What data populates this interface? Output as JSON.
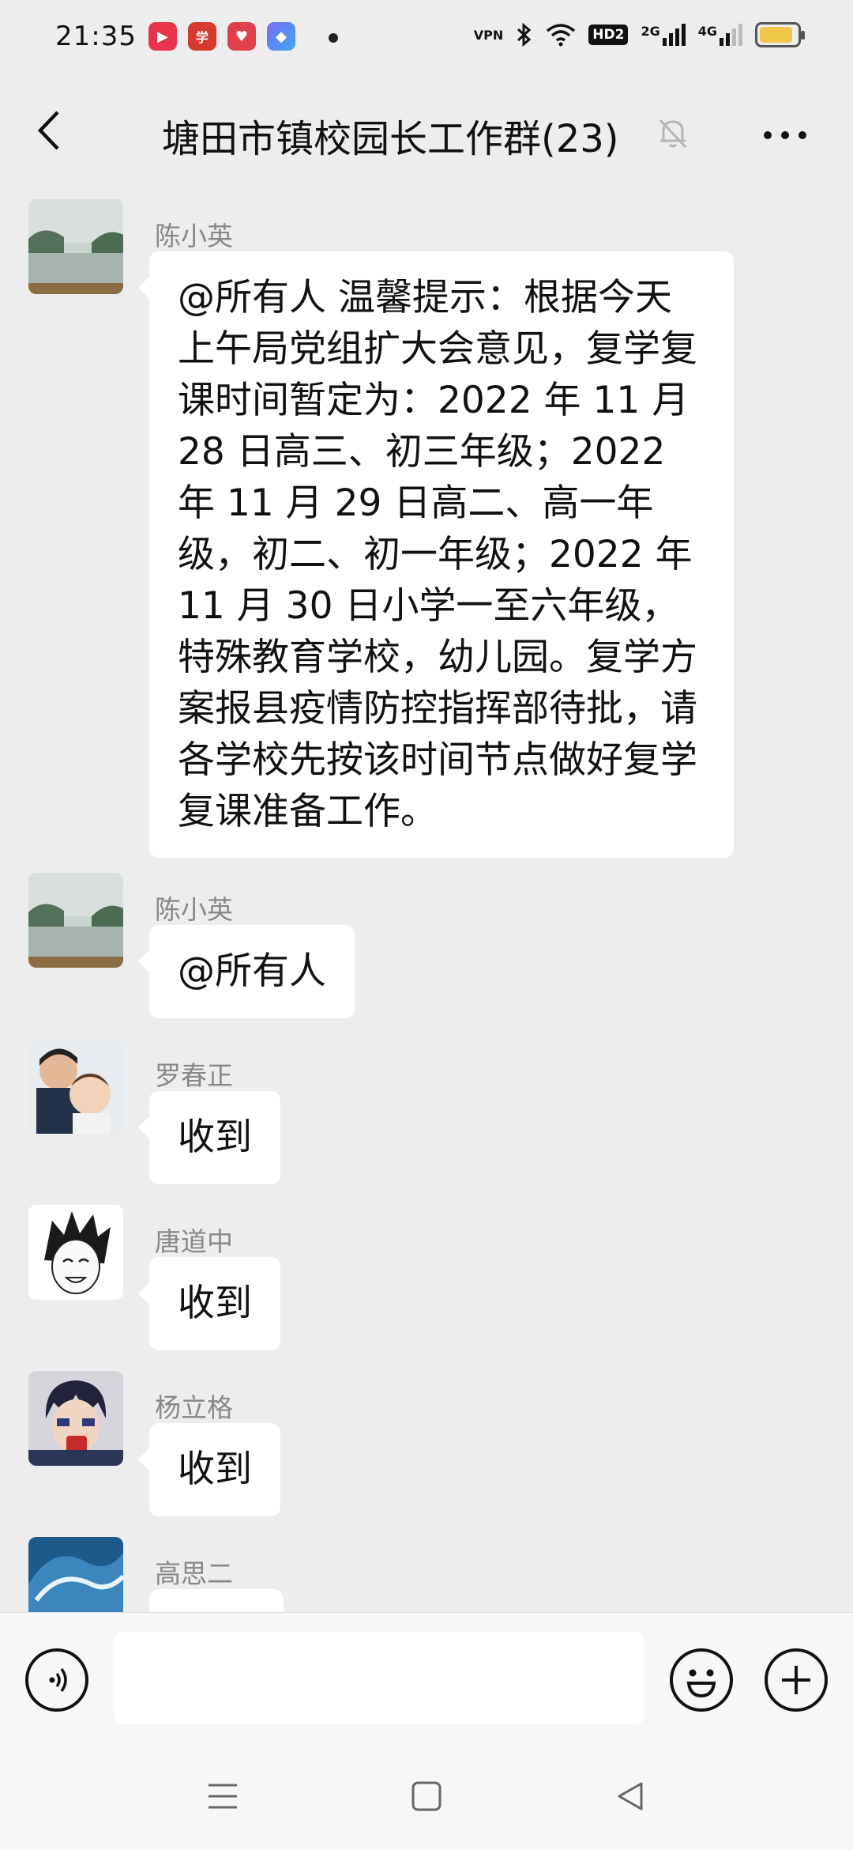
{
  "status_bar": {
    "time": "21:35",
    "apps": [
      {
        "name": "video-app-icon",
        "color": "#e8334a",
        "glyph": "▶"
      },
      {
        "name": "news-app-icon",
        "color": "#d63a2f",
        "glyph": "学"
      },
      {
        "name": "heart-app-icon",
        "color": "#e0404a",
        "glyph": "♥"
      },
      {
        "name": "shortcut-app-icon",
        "color": "#4a7cf0",
        "glyph": "◆"
      }
    ],
    "vpn": "VPN",
    "hd": "HD2",
    "sig1": "2G",
    "sig2": "4G",
    "battery_level": 0.9
  },
  "header": {
    "title": "塘田市镇校园长工作群(23)"
  },
  "messages": [
    {
      "sender": "陈小英",
      "avatar": "landscape-avatar",
      "text": "@所有人  温馨提示：根据今天上午局党组扩大会意见，复学复课时间暂定为：2022 年 11 月 28 日高三、初三年级；2022 年 11 月 29 日高二、高一年级，初二、初一年级；2022 年 11 月 30 日小学一至六年级，特殊教育学校，幼儿园。复学方案报县疫情防控指挥部待批，请各学校先按该时间节点做好复学复课准备工作。"
    },
    {
      "sender": "陈小英",
      "avatar": "landscape-avatar",
      "text": "@所有人"
    },
    {
      "sender": "罗春正",
      "avatar": "family-avatar",
      "text": "收到"
    },
    {
      "sender": "唐道中",
      "avatar": "anime-avatar",
      "text": "收到"
    },
    {
      "sender": "杨立格",
      "avatar": "anime-drink-avatar",
      "text": "收到"
    },
    {
      "sender": "高思二",
      "avatar": "wave-avatar",
      "text": ""
    }
  ],
  "input": {
    "placeholder": ""
  },
  "colors": {
    "background": "#ededed",
    "bubble": "#ffffff",
    "sender": "#888888"
  }
}
